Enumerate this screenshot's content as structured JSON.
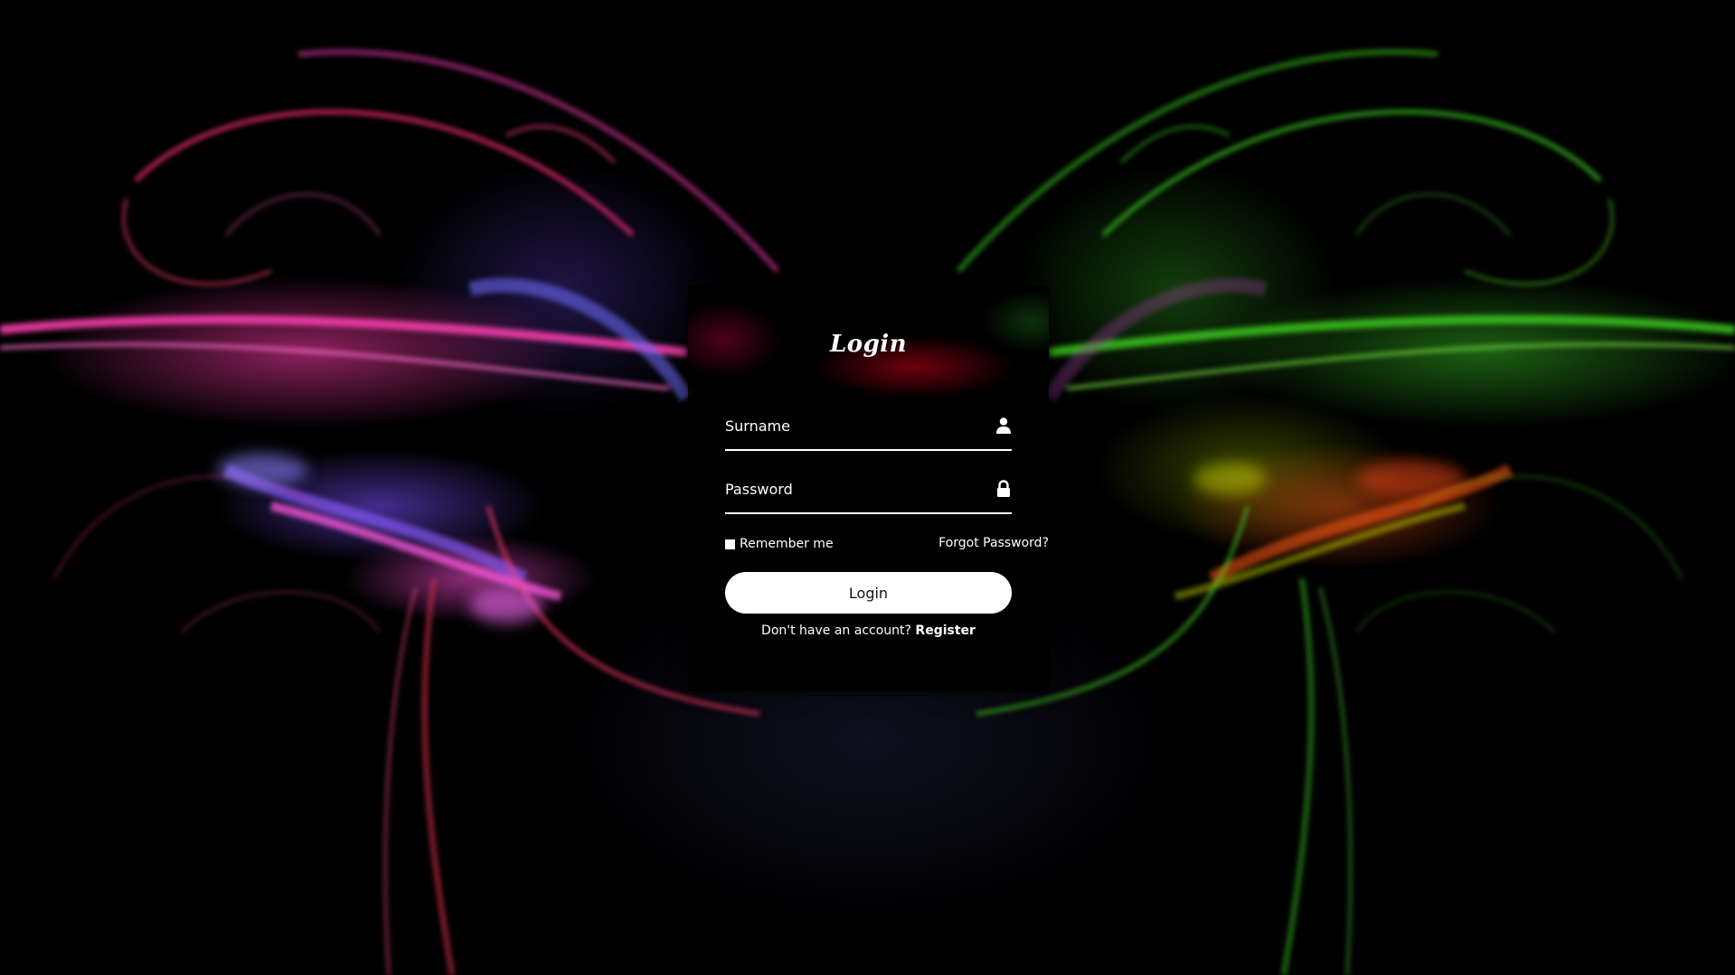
{
  "login": {
    "title": "Login",
    "surname_placeholder": "Surname",
    "password_placeholder": "Password",
    "remember_label": "Remember me",
    "remember_checked": true,
    "forgot_label": "Forgot Password?",
    "submit_label": "Login",
    "register_prompt": "Don't have an account?",
    "register_label": "Register"
  },
  "icons": {
    "surname": "user-icon",
    "password": "lock-icon"
  },
  "colors": {
    "card_background": "#000000",
    "button_background": "#ffffff",
    "text": "#ffffff"
  }
}
